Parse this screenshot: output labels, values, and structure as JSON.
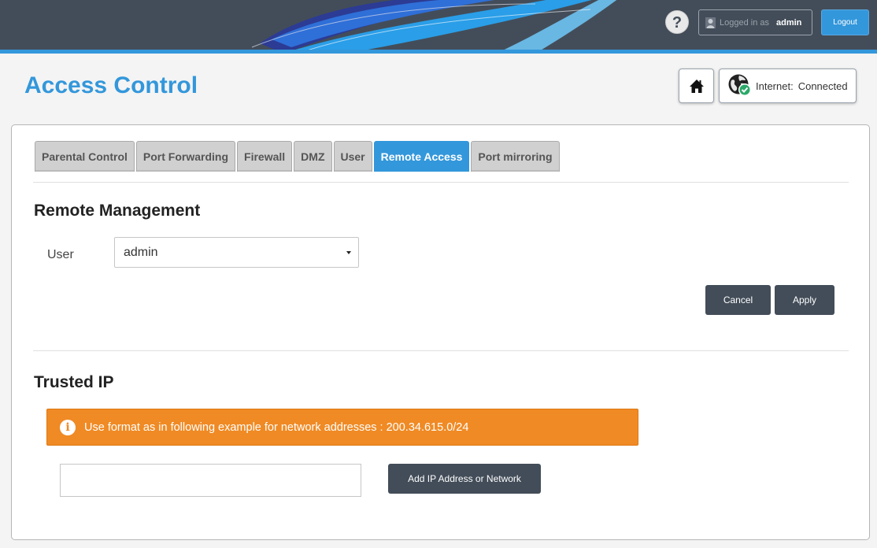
{
  "header": {
    "help_label": "?",
    "logged_in_label": "Logged in as",
    "username": "admin",
    "logout_label": "Logout",
    "accent_color": "#3397db",
    "bar_color": "#434d59"
  },
  "page": {
    "title": "Access Control",
    "home_icon": "home-icon",
    "internet": {
      "label": "Internet:",
      "status": "Connected",
      "icon": "globe-check-icon"
    }
  },
  "tabs": [
    {
      "label": "Parental Control",
      "active": false
    },
    {
      "label": "Port Forwarding",
      "active": false
    },
    {
      "label": "Firewall",
      "active": false
    },
    {
      "label": "DMZ",
      "active": false
    },
    {
      "label": "User",
      "active": false
    },
    {
      "label": "Remote Access",
      "active": true
    },
    {
      "label": "Port mirroring",
      "active": false
    }
  ],
  "remote_management": {
    "title": "Remote Management",
    "user_label": "User",
    "user_value": "admin",
    "cancel_label": "Cancel",
    "apply_label": "Apply"
  },
  "trusted_ip": {
    "title": "Trusted IP",
    "info_text": "Use format as in following example for network addresses : 200.34.615.0/24",
    "alert_color": "#f08a24",
    "input_value": "",
    "add_button_label": "Add IP Address or Network"
  }
}
